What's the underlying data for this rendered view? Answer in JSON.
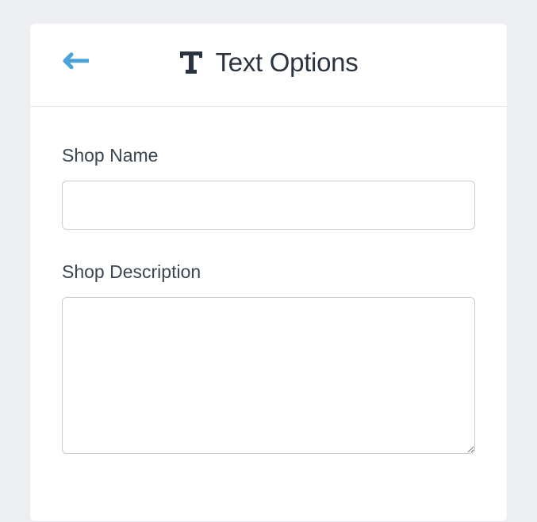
{
  "header": {
    "title": "Text Options"
  },
  "form": {
    "shop_name": {
      "label": "Shop Name",
      "value": ""
    },
    "shop_description": {
      "label": "Shop Description",
      "value": ""
    }
  }
}
